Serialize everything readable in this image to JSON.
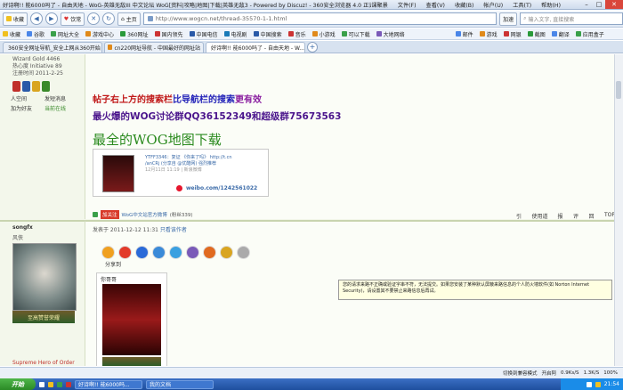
{
  "window": {
    "title": "好诗啊!! 能6000吗了 - 自由天地 - WoG-英雄无敌III 中文论坛 WoG[资料|攻略|地图|下载|英雄无敌3 - Powered by Discuz! - 360安全浏览器 4.0 正式版",
    "menus": [
      "课聚景",
      "文件(F)",
      "查看(V)",
      "收藏(B)",
      "帐户(U)",
      "工具(T)",
      "帮助(H)"
    ]
  },
  "nav": {
    "favorites": "收藏",
    "heart": "饮常",
    "home": "主页",
    "url": "http://www.wogcn.net/thread-35570-1-1.html",
    "accelerate": "加速",
    "search_placeholder": "输入文字, 直接搜索"
  },
  "favbar": {
    "items": [
      "收藏",
      "谷歌",
      "网址大全",
      "游戏中心",
      "360网址",
      "国内领先",
      "中国电信",
      "电视剧",
      "中国搜索",
      "音乐",
      "小游戏",
      "可以下载",
      "大地网络",
      "邮件",
      "游戏",
      "网银",
      "截图",
      "翻译",
      "应用盒子"
    ]
  },
  "tabs": [
    {
      "label": "360安全网址导航_安全上网从360开始"
    },
    {
      "label": "cn220网址导航 - 中国最好的网址站"
    },
    {
      "label": "好诗啊!! 能6000吗了 - 自由天地 - W..."
    }
  ],
  "post1": {
    "left_stats": [
      "Wizard Gold  4466",
      "热心度 Initiative  89",
      "注册时间  2011-2-25"
    ],
    "user_links": [
      "人空间",
      "发短消息",
      "加为好友",
      "当前在线"
    ],
    "line1": {
      "a": "帖子右上方的搜索栏",
      "b": "比导航栏的搜索",
      "c": "更有效"
    },
    "line2": "最火爆的WOG讨论群QQ36152349和超级群75673563",
    "line3": "最全的WOG地图下载",
    "weibo": {
      "line1": "YTFF3346：复证 《你来了吗》  http://t.cn",
      "line2": "/anCRj  (分享自 @优酷网) 强烈推荐",
      "line3": "12月11日 11:19 | 新浪微博",
      "link": "weibo.com/1242561022"
    },
    "actions": {
      "join": "加关注",
      "group": "WoG中文站官方微博",
      "fans": "(粉丝339)"
    },
    "postlinks": [
      "引用",
      "使用道具",
      "报告",
      "评分",
      "回复",
      "TOP"
    ]
  },
  "tooltip": "您的请求来路不正确或验证字串不符，无法提交。如果您安装了某种默认屏蔽来路信息的个人防火墙软件(如 Norton Internet Security)，请设置其不要禁止来路信息后再试。",
  "post2": {
    "username": "songfx",
    "status": "风侠",
    "badge": "至高赞誉荣耀",
    "title": "Supreme Hero of Order",
    "date_prefix": "发表于 2011-12-12 11:31 ",
    "date_link": "只看该作者",
    "share": "分享到",
    "attach_caption": "你哥哥"
  },
  "statusbar": {
    "items": [
      "切换到兼容模式",
      "开启阿",
      "0.9Ks/S",
      "1.3K/S",
      "100%"
    ]
  },
  "taskbar": {
    "start": "开始",
    "tasks": [
      "好诗啊!! 能6000吗...",
      "我的文档"
    ],
    "clock": "21:54"
  }
}
